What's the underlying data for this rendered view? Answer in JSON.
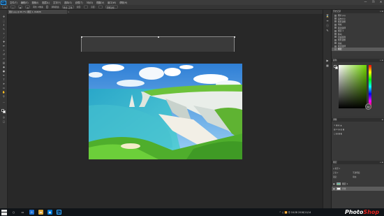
{
  "app": {
    "logo_text": "Ps",
    "menu": [
      "文件(F)",
      "编辑(E)",
      "图像(I)",
      "图层(L)",
      "文字(Y)",
      "选择(S)",
      "滤镜(T)",
      "3D(D)",
      "视图(V)",
      "窗口(W)",
      "帮助(H)"
    ],
    "window_controls": [
      "—",
      "❐",
      "✕"
    ]
  },
  "options_bar": {
    "items": [
      "▭▾",
      "▢",
      "▣",
      "▤",
      "羽化: 0像素",
      "消除锯齿",
      "样式: 正常",
      "宽度:",
      "高度:",
      "调整边缘..."
    ]
  },
  "document": {
    "tab_label": "图片.jpg @ 66.7% (图层 1, RGB/8)",
    "close": "×"
  },
  "history_panel": {
    "title": "历史记录",
    "controls": "» ≡",
    "items": [
      {
        "label": "图片.jpg",
        "selected": false
      },
      {
        "label": "画布大小",
        "selected": false
      },
      {
        "label": "矩形选框",
        "selected": false
      },
      {
        "label": "填充",
        "selected": false
      },
      {
        "label": "取消选择",
        "selected": false
      },
      {
        "label": "图层 1",
        "selected": false
      },
      {
        "label": "移动",
        "selected": false
      },
      {
        "label": "自由变换",
        "selected": false
      },
      {
        "label": "矩形选框",
        "selected": false
      },
      {
        "label": "填充",
        "selected": false
      },
      {
        "label": "取消选择",
        "selected": false
      },
      {
        "label": "图层",
        "selected": true
      }
    ]
  },
  "color_panel": {
    "title": "颜色",
    "controls": "» ≡",
    "zoom_value": "64",
    "hue_accent": "#6fd400"
  },
  "adjust_panel": {
    "title": "调整",
    "rows": [
      "☀ ▦ ◐ ▲",
      "▧ ⚖ ◑ ▥ ▦",
      "□ ▨ ▩ ◧"
    ]
  },
  "layers_panel": {
    "title": "图层",
    "controls": "» ≡",
    "mini": [
      "ρ 类型 ▾",
      "正常 ▾",
      "不透明度:",
      "锁定:",
      "填充:"
    ],
    "layers": [
      {
        "name": "图层 1",
        "thumb": "photo",
        "selected": false
      },
      {
        "name": "背景",
        "thumb": "white",
        "selected": true
      }
    ]
  },
  "taskbar": {
    "tray_text": "^ ♫ 📶 中 16:28 2018/11/14",
    "watermark_main": "Photo",
    "watermark_accent": "Shop"
  },
  "colors": {
    "ps_accent": "#31a8ff",
    "watermark_accent": "#e8231f"
  }
}
